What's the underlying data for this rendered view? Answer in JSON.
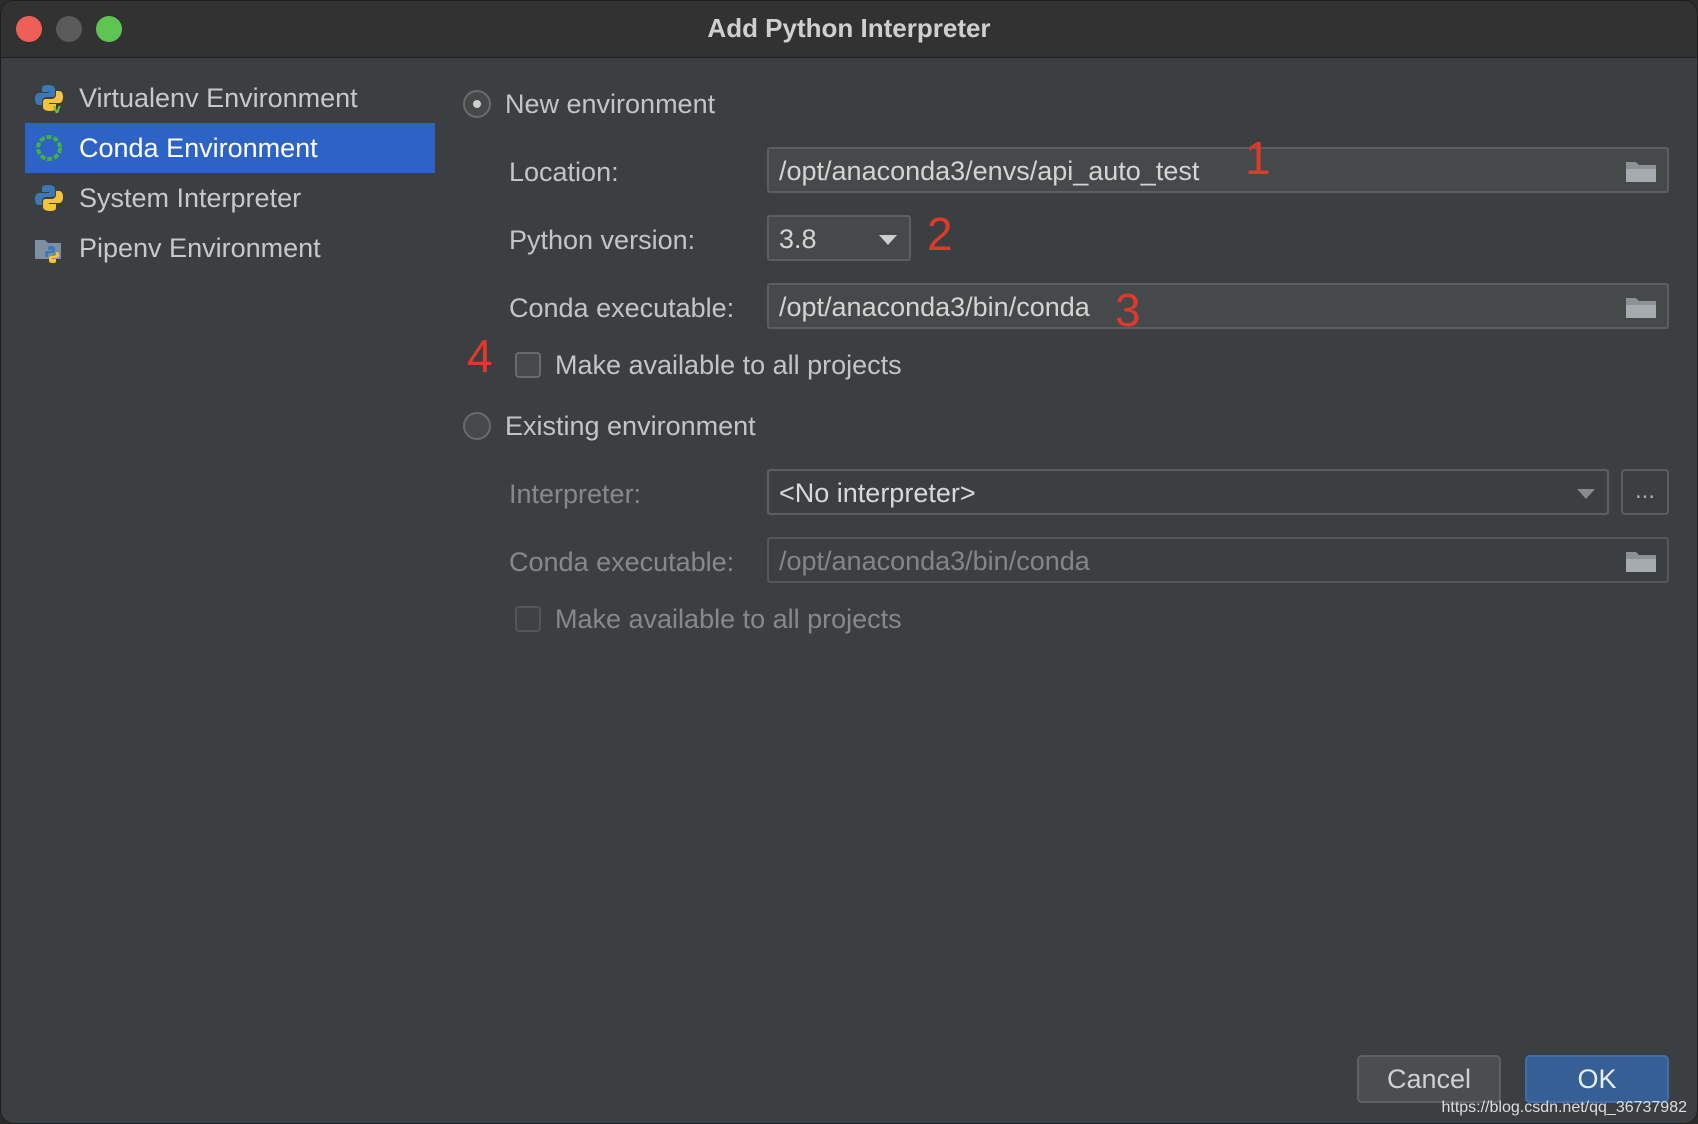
{
  "window": {
    "title": "Add Python Interpreter"
  },
  "sidebar": {
    "items": [
      {
        "label": "Virtualenv Environment",
        "icon": "python-virtualenv-icon",
        "selected": false
      },
      {
        "label": "Conda Environment",
        "icon": "conda-icon",
        "selected": true
      },
      {
        "label": "System Interpreter",
        "icon": "python-icon",
        "selected": false
      },
      {
        "label": "Pipenv Environment",
        "icon": "pipenv-icon",
        "selected": false
      }
    ]
  },
  "new_env": {
    "radio_label": "New environment",
    "selected": true,
    "location_label": "Location:",
    "location_value": "/opt/anaconda3/envs/api_auto_test",
    "python_version_label": "Python version:",
    "python_version_value": "3.8",
    "conda_exec_label": "Conda executable:",
    "conda_exec_value": "/opt/anaconda3/bin/conda",
    "make_available_label": "Make available to all projects",
    "make_available_checked": false
  },
  "existing_env": {
    "radio_label": "Existing environment",
    "selected": false,
    "interpreter_label": "Interpreter:",
    "interpreter_value": "<No interpreter>",
    "browse_label": "...",
    "conda_exec_label": "Conda executable:",
    "conda_exec_value": "/opt/anaconda3/bin/conda",
    "make_available_label": "Make available to all projects",
    "make_available_checked": false
  },
  "annotations": [
    "1",
    "2",
    "3",
    "4"
  ],
  "buttons": {
    "cancel": "Cancel",
    "ok": "OK"
  },
  "watermark": "https://blog.csdn.net/qq_36737982",
  "colors": {
    "accent": "#2e63c6",
    "annotation": "#e0392b",
    "ok_button": "#365f96"
  }
}
